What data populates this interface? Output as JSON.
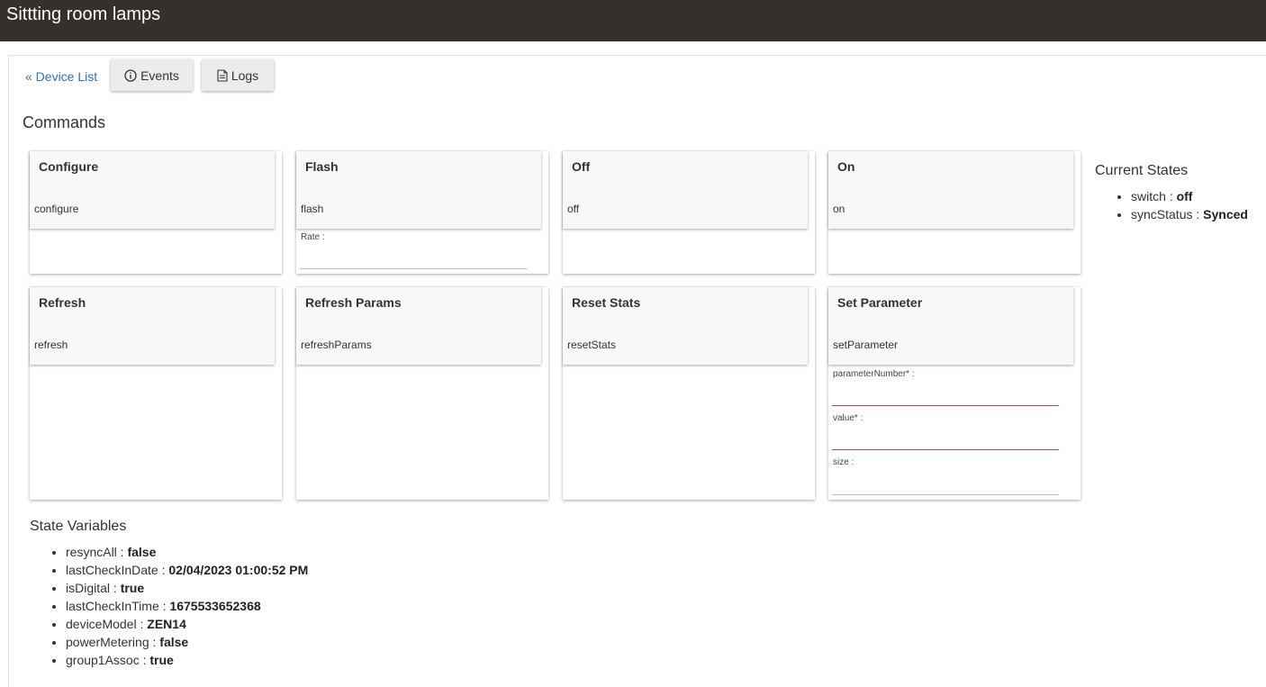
{
  "header": {
    "title": "Sittting room lamps"
  },
  "nav": {
    "device_list": "« Device List",
    "events_label": "Events",
    "logs_label": "Logs"
  },
  "commands": {
    "title": "Commands",
    "items": [
      {
        "title": "Configure",
        "command": "configure",
        "params": []
      },
      {
        "title": "Flash",
        "command": "flash",
        "params": [
          {
            "label": "Rate :",
            "required": false
          }
        ]
      },
      {
        "title": "Off",
        "command": "off",
        "params": []
      },
      {
        "title": "On",
        "command": "on",
        "params": []
      },
      {
        "title": "Refresh",
        "command": "refresh",
        "params": []
      },
      {
        "title": "Refresh Params",
        "command": "refreshParams",
        "params": []
      },
      {
        "title": "Reset Stats",
        "command": "resetStats",
        "params": []
      },
      {
        "title": "Set Parameter",
        "command": "setParameter",
        "params": [
          {
            "label": "parameterNumber* :",
            "required": true
          },
          {
            "label": "value* :",
            "required": true
          },
          {
            "label": "size :",
            "required": false
          }
        ]
      }
    ]
  },
  "current_states": {
    "title": "Current States",
    "items": [
      {
        "key": "switch",
        "sep": " : ",
        "value": "off"
      },
      {
        "key": "syncStatus",
        "sep": " : ",
        "value": "Synced"
      }
    ]
  },
  "state_variables": {
    "title": "State Variables",
    "items": [
      {
        "key": "resyncAll",
        "sep": " : ",
        "value": "false"
      },
      {
        "key": "lastCheckInDate",
        "sep": " : ",
        "value": "02/04/2023 01:00:52 PM"
      },
      {
        "key": "isDigital",
        "sep": " : ",
        "value": "true"
      },
      {
        "key": "lastCheckInTime",
        "sep": " : ",
        "value": "1675533652368"
      },
      {
        "key": "deviceModel",
        "sep": " : ",
        "value": "ZEN14"
      },
      {
        "key": "powerMetering",
        "sep": " : ",
        "value": "false"
      },
      {
        "key": "group1Assoc",
        "sep": " : ",
        "value": "true"
      }
    ]
  },
  "colors": {
    "header_bg": "#35302d",
    "link": "#2a72c2",
    "required_underline": "#b04a5a"
  },
  "icons": {
    "events": "info-circle-icon",
    "logs": "document-icon"
  }
}
